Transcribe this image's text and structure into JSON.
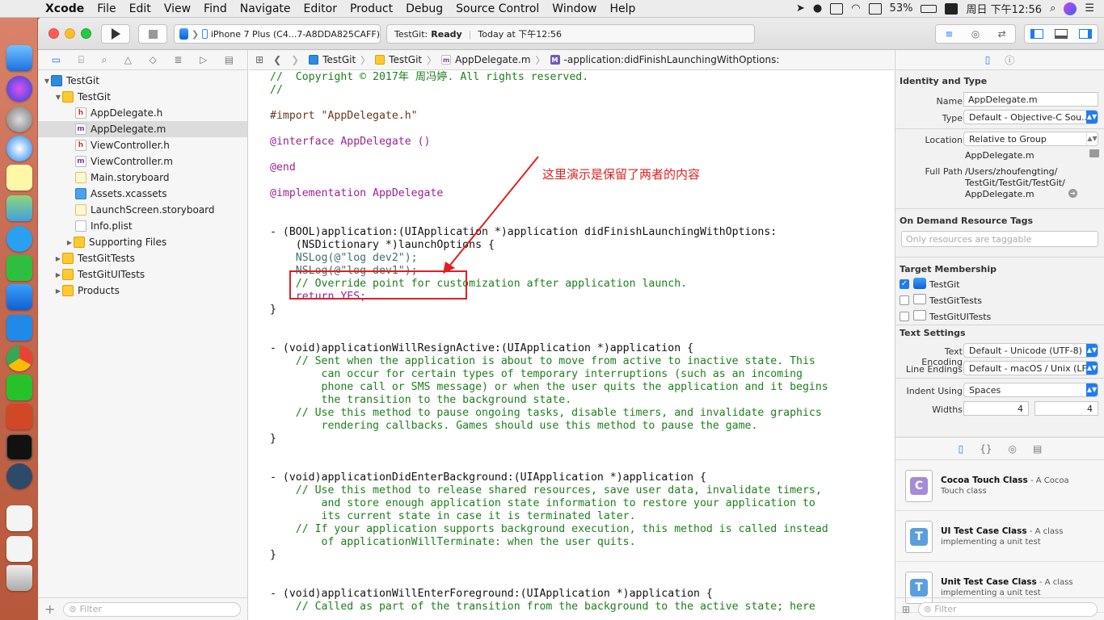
{
  "menubar": {
    "app": "Xcode",
    "items": [
      "File",
      "Edit",
      "View",
      "Find",
      "Navigate",
      "Editor",
      "Product",
      "Debug",
      "Source Control",
      "Window",
      "Help"
    ],
    "battery": "53%",
    "clock": "周日 下午12:56"
  },
  "toolbar": {
    "scheme": "iPhone 7 Plus (C4...7-A8DDA825CAFF)",
    "status_project": "TestGit:",
    "status_state": "Ready",
    "status_time": "Today at 下午12:56"
  },
  "navigator": {
    "items": [
      {
        "label": "TestGit",
        "type": "proj"
      },
      {
        "label": "TestGit",
        "type": "folder"
      },
      {
        "label": "AppDelegate.h",
        "type": "h"
      },
      {
        "label": "AppDelegate.m",
        "type": "m"
      },
      {
        "label": "ViewController.h",
        "type": "h"
      },
      {
        "label": "ViewController.m",
        "type": "m"
      },
      {
        "label": "Main.storyboard",
        "type": "sb"
      },
      {
        "label": "Assets.xcassets",
        "type": "xc"
      },
      {
        "label": "LaunchScreen.storyboard",
        "type": "sb"
      },
      {
        "label": "Info.plist",
        "type": "pl"
      },
      {
        "label": "Supporting Files",
        "type": "folder"
      },
      {
        "label": "TestGitTests",
        "type": "folder"
      },
      {
        "label": "TestGitUITests",
        "type": "folder"
      },
      {
        "label": "Products",
        "type": "folder"
      }
    ],
    "filter_placeholder": "Filter"
  },
  "jumpbar": {
    "crumbs": [
      "TestGit",
      "TestGit",
      "AppDelegate.m",
      "-application:didFinishLaunchingWithOptions:"
    ]
  },
  "annotation": "这里演示是保留了两者的内容",
  "code": [
    "//  Copyright © 2017年 周冯婷. All rights reserved.",
    "//",
    "#import \"AppDelegate.h\"",
    "@interface AppDelegate ()",
    "@end",
    "@implementation AppDelegate",
    "- (BOOL)application:(UIApplication *)application didFinishLaunchingWithOptions:",
    "    (NSDictionary *)launchOptions {",
    "    NSLog(@\"log dev2\");",
    "    NSLog(@\"log dev1\");",
    "    // Override point for customization after application launch.",
    "    return YES;",
    "}",
    "- (void)applicationWillResignActive:(UIApplication *)application {",
    "    // Sent when the application is about to move from active to inactive state. This",
    "        can occur for certain types of temporary interruptions (such as an incoming",
    "        phone call or SMS message) or when the user quits the application and it begins",
    "        the transition to the background state.",
    "    // Use this method to pause ongoing tasks, disable timers, and invalidate graphics",
    "        rendering callbacks. Games should use this method to pause the game.",
    "}",
    "- (void)applicationDidEnterBackground:(UIApplication *)application {",
    "    // Use this method to release shared resources, save user data, invalidate timers,",
    "        and store enough application state information to restore your application to",
    "        its current state in case it is terminated later.",
    "    // If your application supports background execution, this method is called instead",
    "        of applicationWillTerminate: when the user quits.",
    "}",
    "- (void)applicationWillEnterForeground:(UIApplication *)application {",
    "    // Called as part of the transition from the background to the active state; here"
  ],
  "inspector": {
    "identity_title": "Identity and Type",
    "name_label": "Name",
    "name_value": "AppDelegate.m",
    "type_label": "Type",
    "type_value": "Default - Objective-C Sou...",
    "location_label": "Location",
    "location_value": "Relative to Group",
    "location_file": "AppDelegate.m",
    "fullpath_label": "Full Path",
    "fullpath_value": [
      "/Users/zhoufengting/",
      "TestGit/TestGit/TestGit/",
      "AppDelegate.m"
    ],
    "odr_title": "On Demand Resource Tags",
    "odr_placeholder": "Only resources are taggable",
    "membership_title": "Target Membership",
    "targets": [
      {
        "label": "TestGit",
        "checked": true
      },
      {
        "label": "TestGitTests",
        "checked": false
      },
      {
        "label": "TestGitUITests",
        "checked": false
      }
    ],
    "text_settings_title": "Text Settings",
    "encoding_label": "Text Encoding",
    "encoding_value": "Default - Unicode (UTF-8)",
    "endings_label": "Line Endings",
    "endings_value": "Default - macOS / Unix (LF)",
    "indent_label": "Indent Using",
    "indent_value": "Spaces",
    "widths_label": "Widths",
    "tab_width": "4",
    "indent_width": "4"
  },
  "library": {
    "templates": [
      {
        "title": "Cocoa Touch Class",
        "desc": " - A Cocoa Touch class",
        "badge": "C",
        "color": "#a68bd6"
      },
      {
        "title": "UI Test Case Class",
        "desc": " - A class implementing a unit test",
        "badge": "T",
        "color": "#5a9fdc"
      },
      {
        "title": "Unit Test Case Class",
        "desc": " - A class implementing a unit test",
        "badge": "T",
        "color": "#5a9fdc"
      }
    ],
    "filter_placeholder": "Filter"
  }
}
